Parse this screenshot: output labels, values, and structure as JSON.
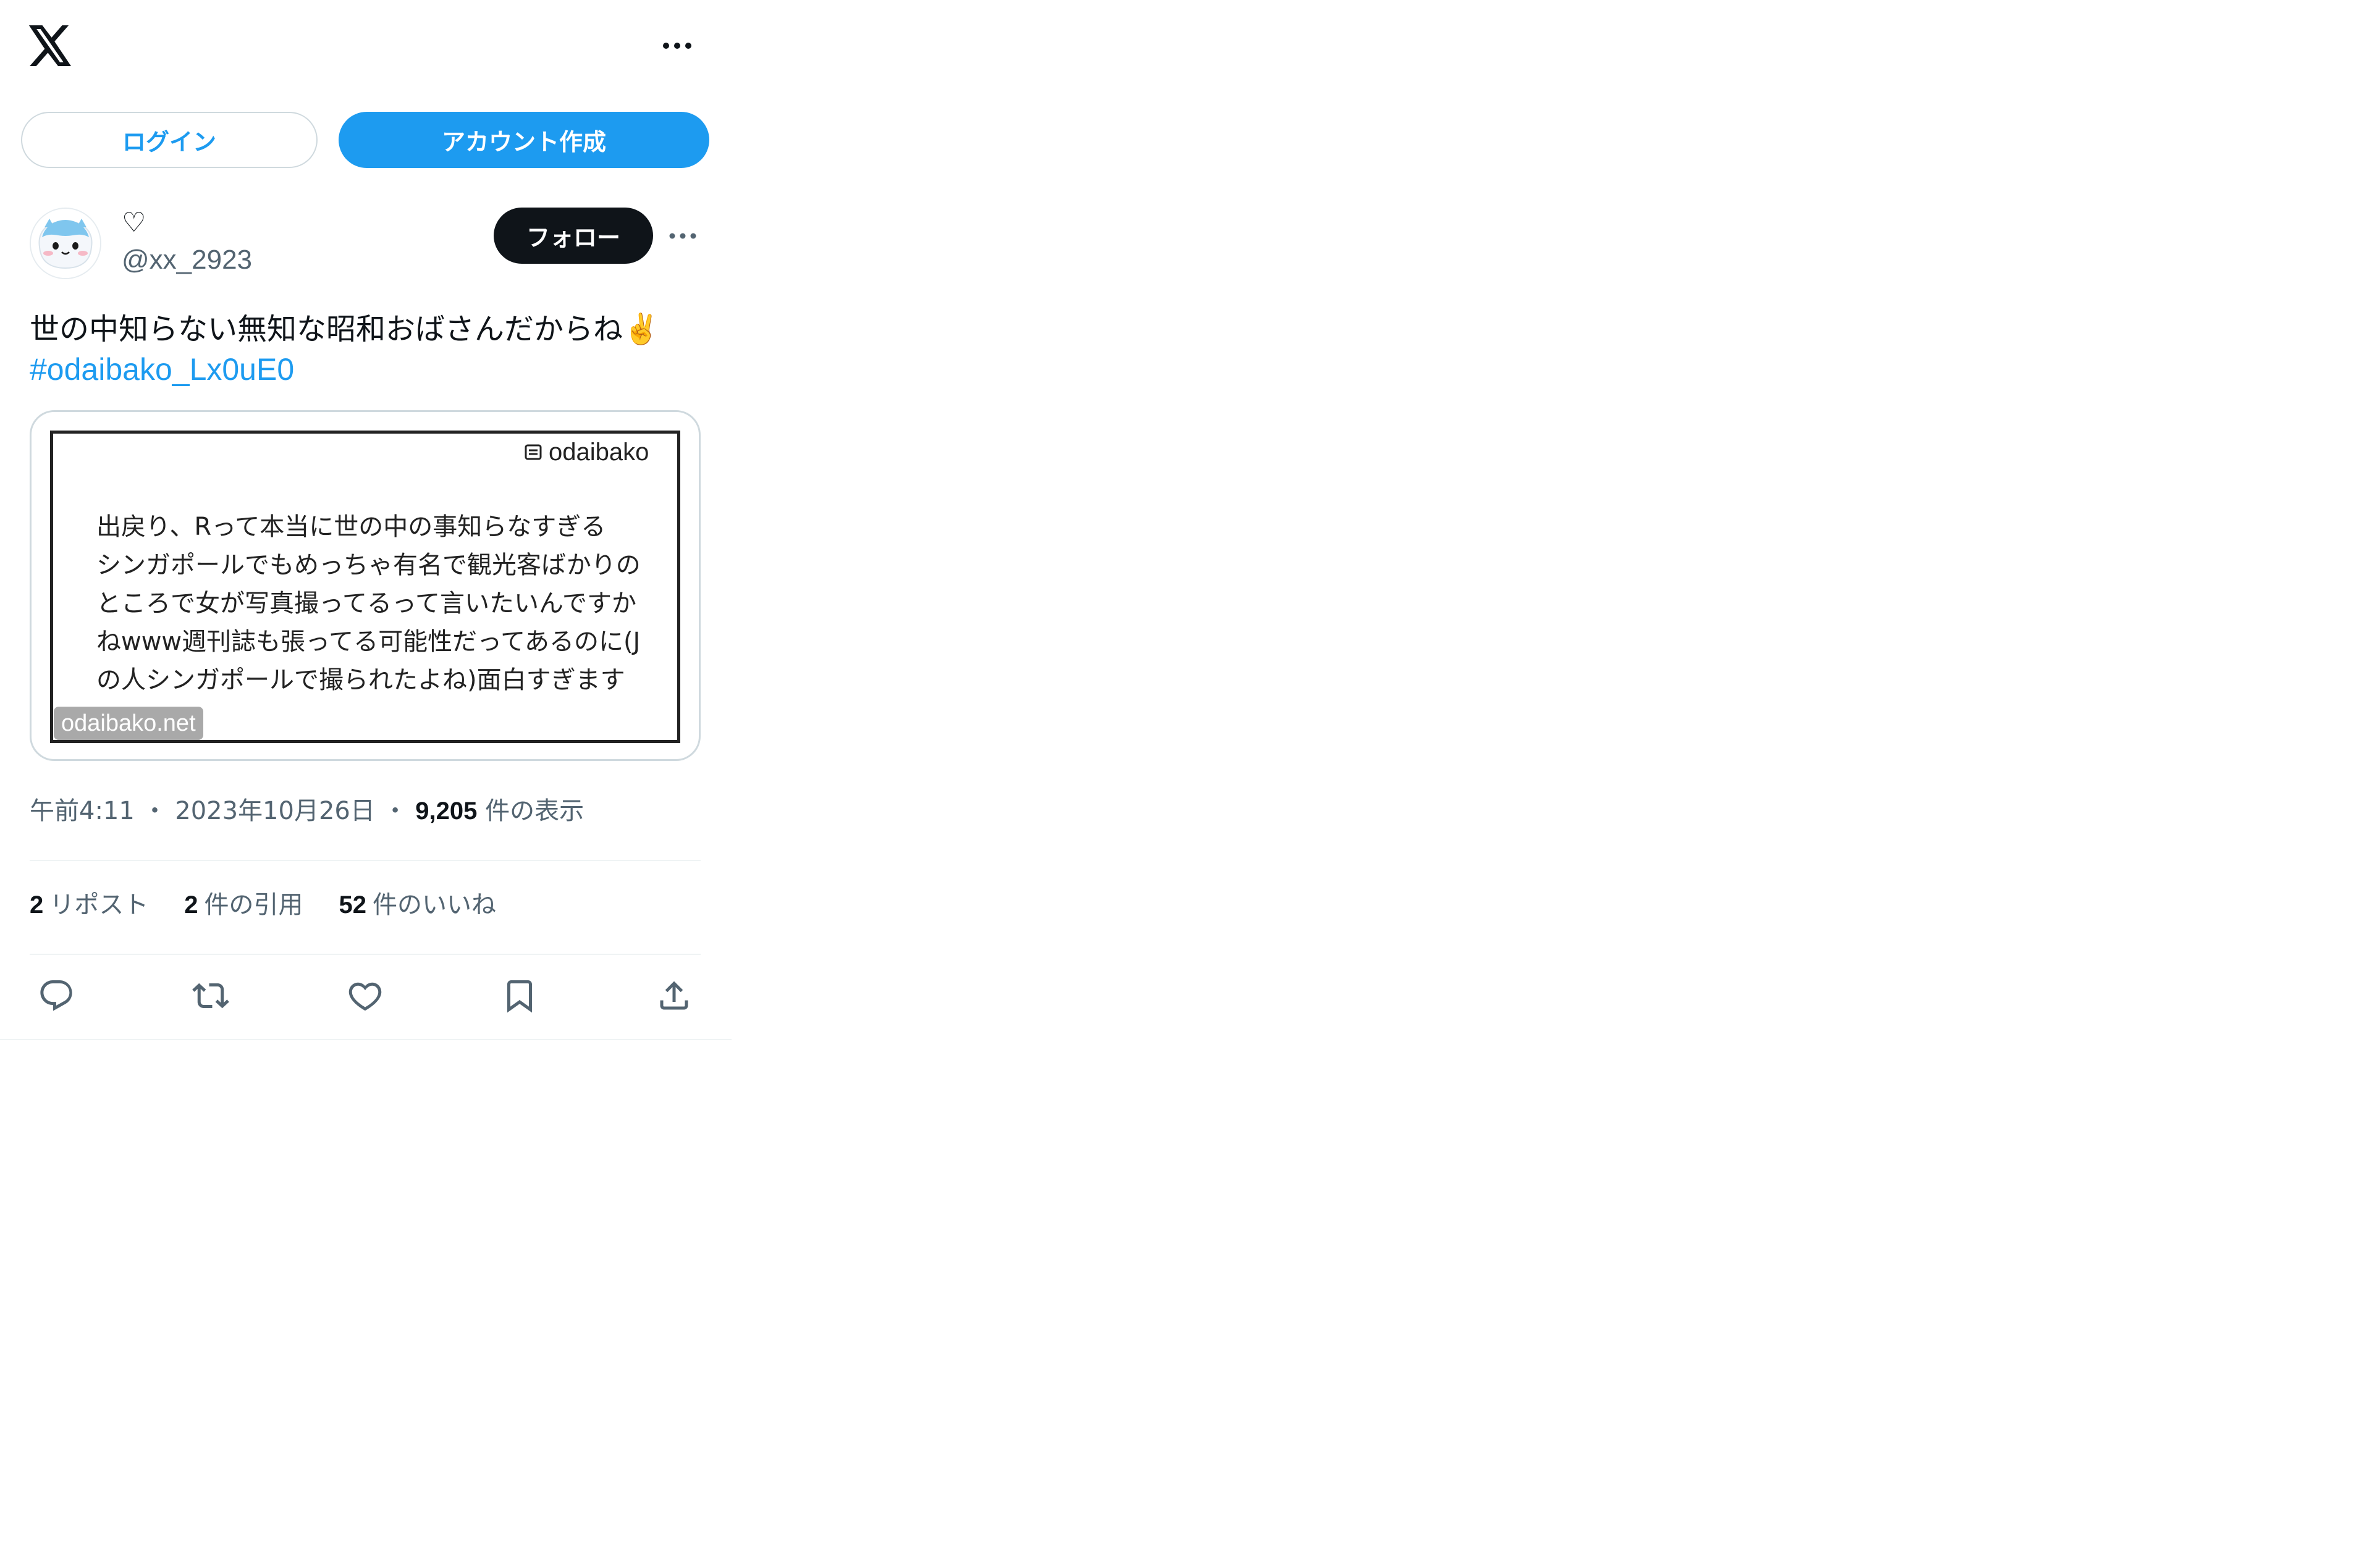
{
  "header": {
    "logo_icon": "x-logo-icon",
    "more_icon": "more-horizontal-icon",
    "login_label": "ログイン",
    "create_account_label": "アカウント作成"
  },
  "colors": {
    "accent": "#1d9bf0",
    "text_primary": "#0f1419",
    "text_secondary": "#536471",
    "border": "#cfd9de"
  },
  "tweet": {
    "author": {
      "display_name": "♡",
      "handle": "@xx_2923",
      "avatar_icon": "cat-avatar-icon"
    },
    "follow_label": "フォロー",
    "text": "世の中知らない無知な昭和おばさんだからね✌️",
    "hashtag": "#odaibako_Lx0uE0",
    "card": {
      "brand": "odaibako",
      "brand_icon": "inbox-icon",
      "body": "出戻り、Rって本当に世の中の事知らなすぎる\nシンガポールでもめっちゃ有名で観光客ばかりの\nところで女が写真撮ってるって言いたいんですか\nねwww週刊誌も張ってる可能性だってあるのに(J\nの人シンガポールで撮られたよね)面白すぎます",
      "domain": "odaibako.net"
    },
    "meta": {
      "time": "午前4:11",
      "date": "2023年10月26日",
      "views_count": "9,205",
      "views_label": "件の表示",
      "separator": "・"
    },
    "stats": {
      "reposts_count": "2",
      "reposts_label": "リポスト",
      "quotes_count": "2",
      "quotes_label": "件の引用",
      "likes_count": "52",
      "likes_label": "件のいいね"
    },
    "actions": [
      "reply-icon",
      "repost-icon",
      "like-icon",
      "bookmark-icon",
      "share-icon"
    ]
  }
}
